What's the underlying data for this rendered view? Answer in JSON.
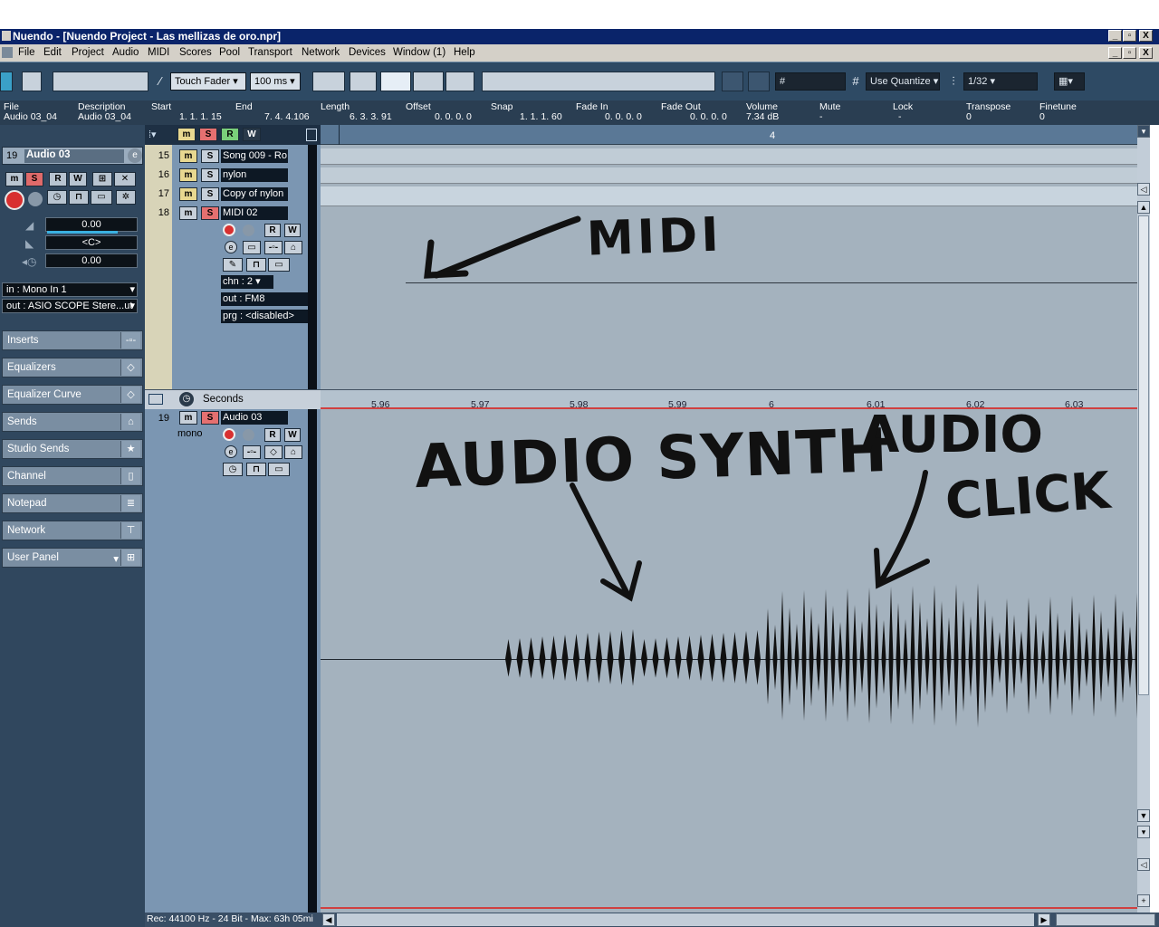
{
  "window": {
    "title": "Nuendo - [Nuendo Project - Las mellizas de oro.npr]",
    "controls": [
      "_",
      "▫",
      "X"
    ]
  },
  "menu": [
    "File",
    "Edit",
    "Project",
    "Audio",
    "MIDI",
    "Scores",
    "Pool",
    "Transport",
    "Network",
    "Devices",
    "Window (1)",
    "Help"
  ],
  "toolbar": {
    "automation_mode": "Touch Fader",
    "preroll": "100 ms",
    "quantize_mode": "Use Quantize",
    "quantize_value": "1/32"
  },
  "infoline": {
    "headers": [
      "File",
      "Description",
      "Start",
      "End",
      "Length",
      "Offset",
      "Snap",
      "Fade In",
      "Fade Out",
      "Volume",
      "Mute",
      "Lock",
      "Transpose",
      "Finetune"
    ],
    "values": [
      "Audio 03_04",
      "Audio 03_04",
      "1. 1. 1. 15",
      "7. 4. 4.106",
      "6. 3. 3. 91",
      "0. 0. 0.   0",
      "1. 1. 1. 60",
      "0. 0. 0.   0",
      "0. 0. 0.   0",
      "7.34 dB",
      "-",
      "-",
      "0",
      "0"
    ]
  },
  "inspector": {
    "track_number": "19",
    "track_name": "Audio 03",
    "volume": "0.00",
    "pan": "<C>",
    "delay": "0.00",
    "input": "in :        Mono In 1",
    "output": "out :  ASIO SCOPE Stere...ut",
    "sections": [
      "Inserts",
      "Equalizers",
      "Equalizer Curve",
      "Sends",
      "Studio Sends",
      "Channel",
      "Notepad",
      "Network",
      "User Panel"
    ]
  },
  "tracks": [
    {
      "num": "15",
      "name": "Song 009 - Ro"
    },
    {
      "num": "16",
      "name": "nylon"
    },
    {
      "num": "17",
      "name": "Copy of nylon"
    },
    {
      "num": "18",
      "name": "MIDI 02"
    }
  ],
  "midi_track": {
    "channel": "chn : 2",
    "output": "out : FM8",
    "program": "prg : <disabled>"
  },
  "ruler2": {
    "label": "Seconds",
    "ticks": [
      "5.96",
      "5.97",
      "5.98",
      "5.99",
      "6",
      "6.01",
      "6.02",
      "6.03"
    ]
  },
  "ruler1": {
    "marker": "4"
  },
  "audio_track": {
    "num": "19",
    "name": "Audio 03",
    "mode": "mono"
  },
  "annotations": {
    "midi": "MIDI",
    "synth": "AUDIO SYNTH",
    "click_line1": "AUDIO",
    "click_line2": "CLICK"
  },
  "status": "Rec: 44100 Hz - 24 Bit - Max: 63h 05mi",
  "colors": {
    "title": "#0a246a",
    "toolbar": "#2e4a64",
    "inspector": "#30475e",
    "lane": "#a4b2be",
    "wave": "#101010"
  }
}
